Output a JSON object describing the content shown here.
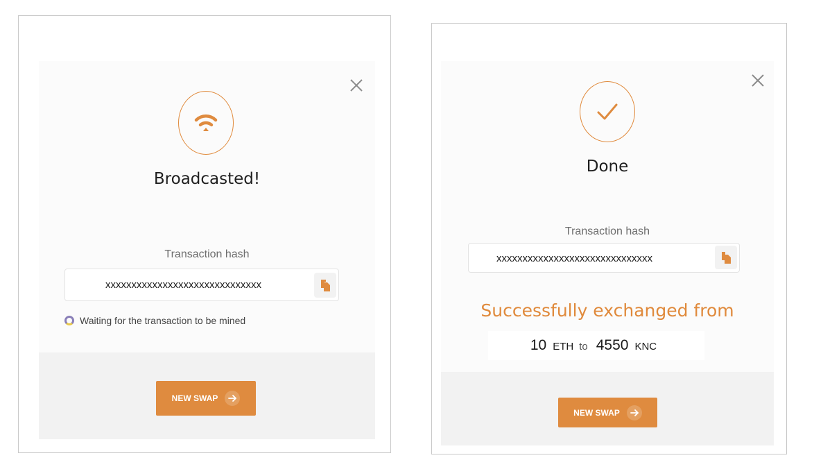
{
  "left_modal": {
    "title": "Broadcasted!",
    "status_icon": "wifi-broadcast-icon",
    "hash_label": "Transaction hash",
    "hash_value": "xxxxxxxxxxxxxxxxxxxxxxxxxxxxxx",
    "waiting_text": "Waiting for the transaction to be mined",
    "button_label": "NEW SWAP"
  },
  "right_modal": {
    "title": "Done",
    "status_icon": "checkmark-icon",
    "hash_label": "Transaction hash",
    "hash_value": "xxxxxxxxxxxxxxxxxxxxxxxxxxxxxx",
    "success_text": "Successfully exchanged from",
    "from_amount": "10",
    "from_symbol": "ETH",
    "to_word": "to",
    "to_amount": "4550",
    "to_symbol": "KNC",
    "button_label": "NEW SWAP"
  },
  "colors": {
    "accent": "#df8b3f",
    "footer_bg": "#f2f2f2",
    "panel_bg": "#fbfbfb"
  }
}
